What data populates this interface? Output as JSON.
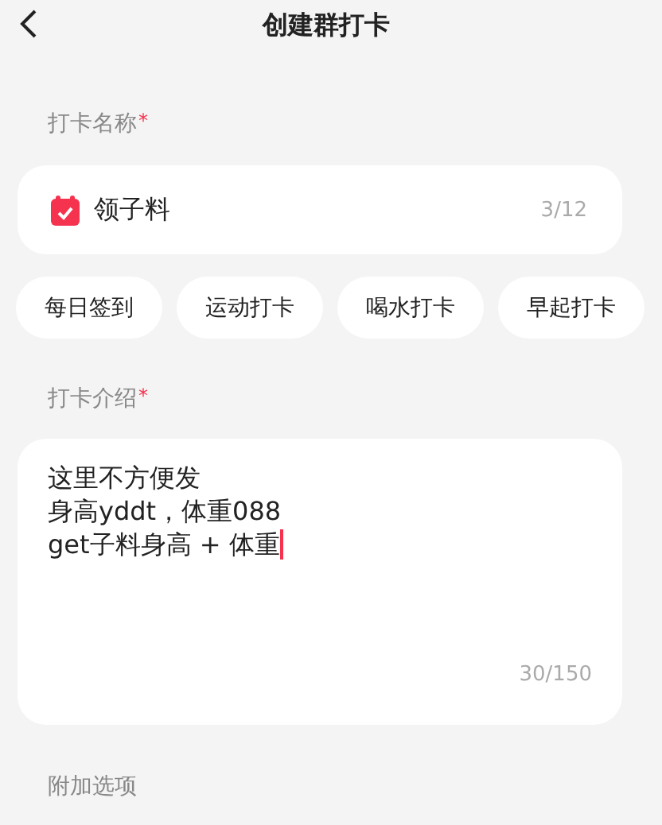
{
  "header": {
    "title": "创建群打卡"
  },
  "name_section": {
    "label": "打卡名称",
    "required_mark": "*",
    "value": "领子料",
    "counter": "3/12"
  },
  "suggestions": [
    {
      "label": "每日签到",
      "selected": false
    },
    {
      "label": "运动打卡",
      "selected": false
    },
    {
      "label": "喝水打卡",
      "selected": false
    },
    {
      "label": "早起打卡",
      "selected": false
    }
  ],
  "intro_section": {
    "label": "打卡介绍",
    "required_mark": "*",
    "lines": [
      "这里不方便发",
      "身高yddt，体重088",
      "get子料身高 + 体重"
    ],
    "focused": true,
    "counter": "30/150"
  },
  "extra_section": {
    "label": "附加选项"
  }
}
